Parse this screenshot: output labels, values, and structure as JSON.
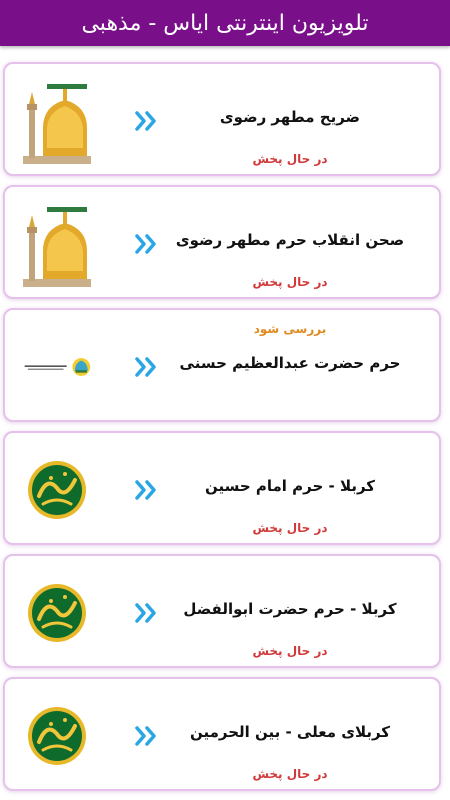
{
  "header": {
    "title": "تلویزیون اینترنتی ایاس - مذهبی"
  },
  "colors": {
    "header_bg": "#7a0f8a",
    "status_red": "#d13a3a",
    "status_orange": "#e08a1e",
    "arrow_blue": "#2aa6e4"
  },
  "channels": [
    {
      "title": "ضریح مطهر رضوی",
      "status": "در حال پخش",
      "icon": "shrine-dome-icon"
    },
    {
      "title": "صحن انقلاب  حرم مطهر رضوی",
      "status": "در حال پخش",
      "icon": "shrine-dome-icon"
    },
    {
      "title": "حرم حضرت عبدالعظیم حسنی",
      "status": "بررسی شود",
      "icon": "shrine-logo-icon"
    },
    {
      "title": "کربلا - حرم امام حسین",
      "status": "در حال پخش",
      "icon": "hussain-calligraphy-icon"
    },
    {
      "title": "کربلا - حرم حضرت ابوالفضل",
      "status": "در حال پخش",
      "icon": "hussain-calligraphy-icon"
    },
    {
      "title": "کربلای معلی - بین الحرمین",
      "status": "در حال پخش",
      "icon": "hussain-calligraphy-icon"
    }
  ]
}
